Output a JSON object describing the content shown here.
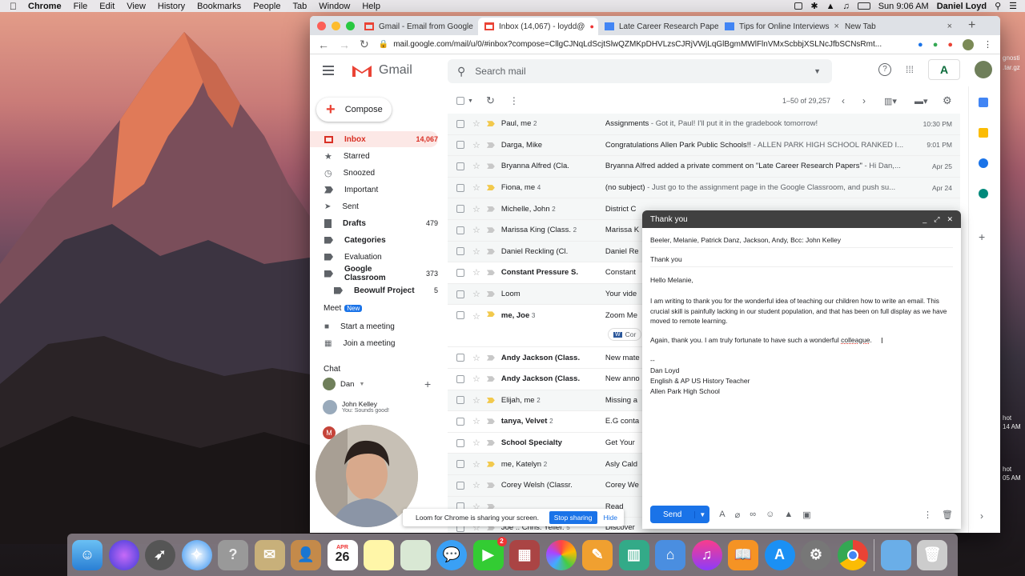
{
  "menubar": {
    "app": "Chrome",
    "items": [
      "File",
      "Edit",
      "View",
      "History",
      "Bookmarks",
      "People",
      "Tab",
      "Window",
      "Help"
    ],
    "clock": "Sun 9:06 AM",
    "user": "Daniel Loyd"
  },
  "browser": {
    "tabs": [
      {
        "title": "Gmail - Email from Google",
        "color": "#ea4335"
      },
      {
        "title": "Inbox (14,067) - loydd@",
        "color": "#ea4335"
      },
      {
        "title": "Late Career Research Paper",
        "color": "#4285f4"
      },
      {
        "title": "Tips for Online Interviews",
        "color": "#4285f4"
      },
      {
        "title": "New Tab",
        "color": "#999999"
      }
    ],
    "url": "mail.google.com/mail/u/0/#inbox?compose=CllgCJNqLdScjtSlwQZMKpDHVLzsCJRjVWjLqGlBgmMWlFlnVMxScbbjXSLNcJfbSCNsRmt..."
  },
  "gmail": {
    "logo": "Gmail",
    "search_placeholder": "Search mail",
    "pagination": "1–50 of 29,257",
    "compose": "Compose",
    "nav": [
      {
        "label": "Inbox",
        "count": "14,067",
        "active": true,
        "icon": "inbox-icon"
      },
      {
        "label": "Starred",
        "count": "",
        "icon": "star-icon"
      },
      {
        "label": "Snoozed",
        "count": "",
        "icon": "clock-icon"
      },
      {
        "label": "Important",
        "count": "",
        "icon": "important-icon"
      },
      {
        "label": "Sent",
        "count": "",
        "icon": "send-icon"
      },
      {
        "label": "Drafts",
        "count": "479",
        "icon": "draft-icon"
      },
      {
        "label": "Categories",
        "count": "",
        "icon": "label-icon"
      },
      {
        "label": "Evaluation",
        "count": "",
        "icon": "label-icon"
      },
      {
        "label": "Google Classroom",
        "count": "373",
        "icon": "label-icon"
      },
      {
        "label": "Beowulf Project",
        "count": "5",
        "icon": "label-icon"
      }
    ],
    "meet": {
      "title": "Meet",
      "badge": "New",
      "start": "Start a meeting",
      "join": "Join a meeting"
    },
    "chat": {
      "title": "Chat",
      "me": "Dan",
      "contact": "John Kelley",
      "preview": "You: Sounds good!"
    },
    "emails": [
      {
        "sender": "Paul, me",
        "count": "2",
        "subject": "Assignments",
        "snippet": " - Got it, Paul! I'll put it in the gradebook tomorrow!",
        "time": "10:30 PM",
        "important": true,
        "bold": false
      },
      {
        "sender": "Darga, Mike",
        "count": "",
        "subject": "Congratulations Allen Park Public Schools!!",
        "snippet": " - ALLEN PARK HIGH SCHOOL RANKED I...",
        "time": "9:01 PM",
        "important": false,
        "bold": false
      },
      {
        "sender": "Bryanna Alfred (Cla.",
        "count": "",
        "subject": "Bryanna Alfred added a private comment on \"Late Career Research Papers\"",
        "snippet": " - Hi Dan,...",
        "time": "Apr 25",
        "important": false,
        "bold": false
      },
      {
        "sender": "Fiona, me",
        "count": "4",
        "subject": "(no subject)",
        "snippet": " - Just go to the assignment page in the Google Classroom, and push su...",
        "time": "Apr 24",
        "important": true,
        "bold": false
      },
      {
        "sender": "Michelle, John",
        "count": "2",
        "subject": "District C",
        "snippet": "",
        "time": "",
        "important": false,
        "bold": false
      },
      {
        "sender": "Marissa King (Class.",
        "count": "2",
        "subject": "Marissa K",
        "snippet": "",
        "time": "",
        "important": false,
        "bold": false
      },
      {
        "sender": "Daniel Reckling (Cl.",
        "count": "",
        "subject": "Daniel Re",
        "snippet": "",
        "time": "",
        "important": false,
        "bold": false
      },
      {
        "sender": "Constant Pressure S.",
        "count": "",
        "subject": "Constant",
        "snippet": "",
        "time": "",
        "important": false,
        "bold": true
      },
      {
        "sender": "Loom",
        "count": "",
        "subject": "Your vide",
        "snippet": "",
        "time": "",
        "important": false,
        "bold": false
      },
      {
        "sender": "me, Joe",
        "count": "3",
        "subject": "Zoom Me",
        "snippet": "",
        "time": "",
        "important": true,
        "bold": true,
        "attachment": "Cor"
      },
      {
        "sender": "Andy Jackson (Class.",
        "count": "",
        "subject": "New mate",
        "snippet": "",
        "time": "",
        "important": false,
        "bold": true
      },
      {
        "sender": "Andy Jackson (Class.",
        "count": "",
        "subject": "New anno",
        "snippet": "",
        "time": "",
        "important": false,
        "bold": true
      },
      {
        "sender": "Elijah, me",
        "count": "2",
        "subject": "Missing a",
        "snippet": "",
        "time": "",
        "important": true,
        "bold": false
      },
      {
        "sender": "tanya, Velvet",
        "count": "2",
        "subject": "E.G conta",
        "snippet": "",
        "time": "",
        "important": false,
        "bold": true
      },
      {
        "sender": "School Specialty",
        "count": "",
        "subject": "Get Your",
        "snippet": "",
        "time": "",
        "important": false,
        "bold": true
      },
      {
        "sender": "me, Katelyn",
        "count": "2",
        "subject": "Asly Cald",
        "snippet": "",
        "time": "",
        "important": true,
        "bold": false
      },
      {
        "sender": "Corey Welsh (Classr.",
        "count": "",
        "subject": "Corey We",
        "snippet": "",
        "time": "",
        "important": false,
        "bold": false
      },
      {
        "sender": "",
        "count": "",
        "subject": "Read",
        "snippet": "",
        "time": "",
        "important": false,
        "bold": false
      },
      {
        "sender": "Joe .. Chris. Yeller.",
        "count": "5",
        "subject": "Discover",
        "snippet": "",
        "time": "",
        "important": false,
        "bold": false
      }
    ]
  },
  "compose_window": {
    "title": "Thank you",
    "recipients": "Beeler, Melanie, Patrick Danz, Jackson, Andy, Bcc: John Kelley",
    "subject": "Thank you",
    "greeting": "Hello Melanie,",
    "para1": "I am writing to thank you for the wonderful idea of teaching our children how to write an email. This crucial skill is painfully lacking in our student population, and that has been on full display as we have moved to remote learning.",
    "para2_pre": "Again, thank you. I am truly fortunate to have such a wonderful ",
    "para2_word": "colleague",
    "para2_post": ".",
    "sig_sep": "--",
    "sig_name": "Dan Loyd",
    "sig_title": "English & AP US History Teacher",
    "sig_school": "Allen Park High School",
    "send": "Send"
  },
  "loom": {
    "message": "Loom for Chrome is sharing your screen.",
    "stop": "Stop sharing",
    "hide": "Hide"
  },
  "desktop": {
    "labels": [
      "gnosti",
      ".tar.gz",
      "hot",
      "14 AM",
      "hot",
      "05 AM",
      "hot",
      "05 AM"
    ]
  },
  "dock": {
    "calendar_month": "APR",
    "calendar_day": "26",
    "facetime_badge": "2"
  }
}
